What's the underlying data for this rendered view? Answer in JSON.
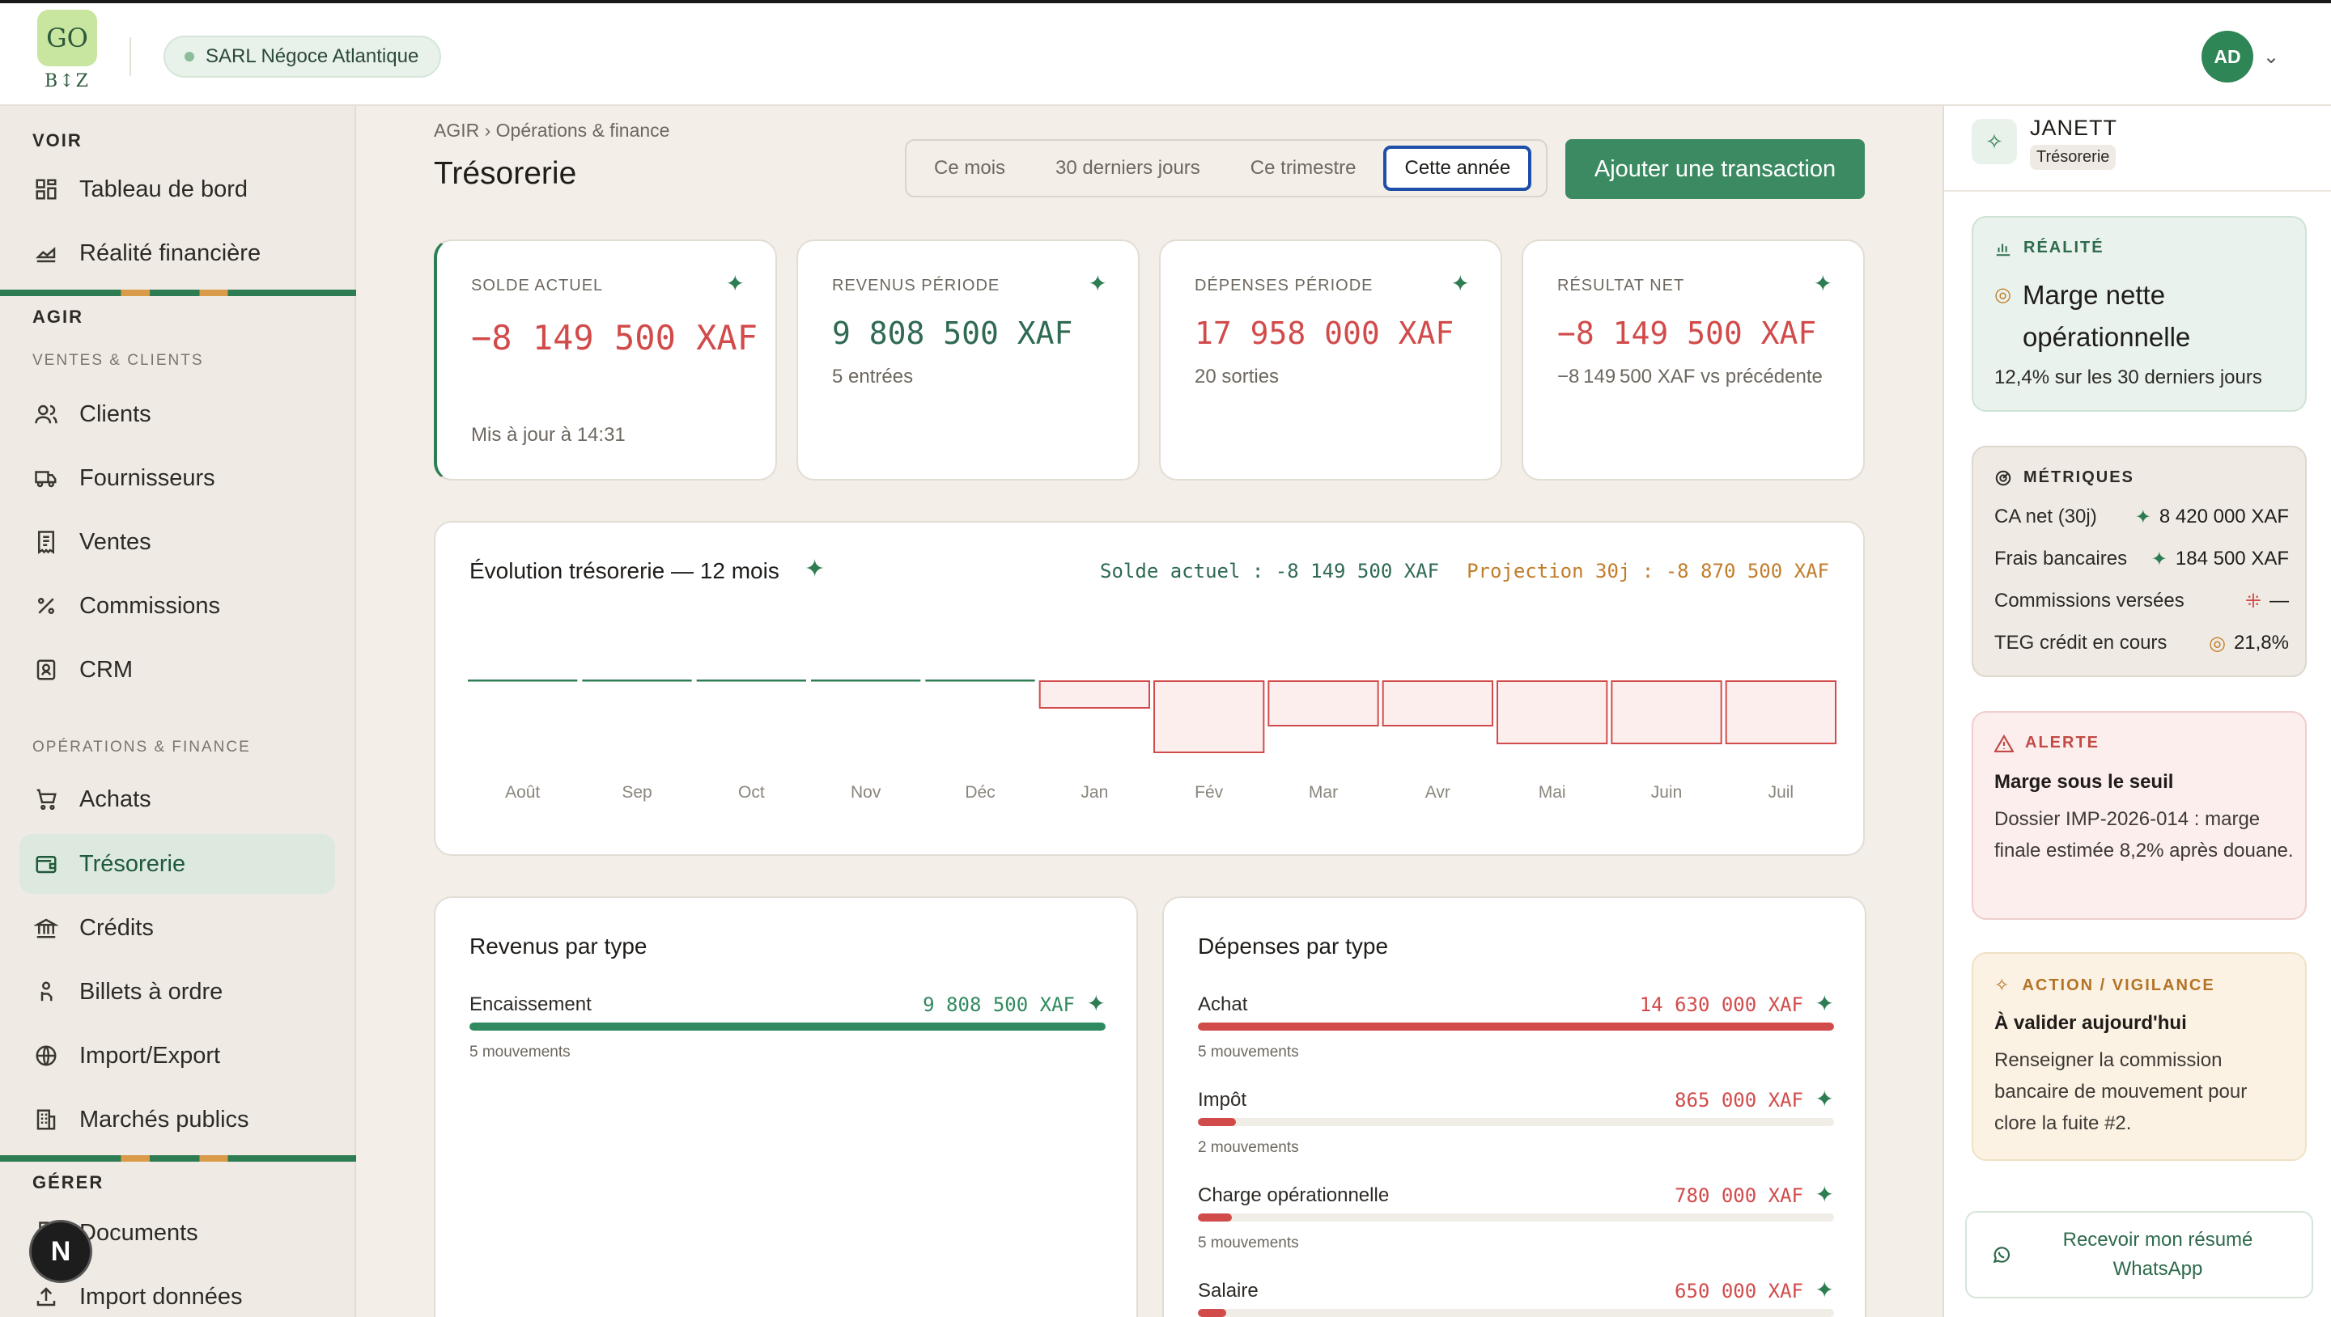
{
  "app": {
    "logo_top": "GO",
    "logo_bottom": "B↕Z",
    "company": "SARL Négoce Atlantique",
    "user_initials": "AD"
  },
  "sidebar": {
    "sec_voir": "VOIR",
    "voir_items": [
      "Tableau de bord",
      "Réalité financière"
    ],
    "sec_agir": "AGIR",
    "sub_ventes": "VENTES & CLIENTS",
    "ventes_items": [
      "Clients",
      "Fournisseurs",
      "Ventes",
      "Commissions",
      "CRM"
    ],
    "sub_ops": "OPÉRATIONS & FINANCE",
    "ops_items": [
      "Achats",
      "Trésorerie",
      "Crédits",
      "Billets à ordre",
      "Import/Export",
      "Marchés publics"
    ],
    "sec_gerer": "GÉRER",
    "gerer_items": [
      "Documents",
      "Import données"
    ],
    "fab": "N"
  },
  "page": {
    "breadcrumb": "AGIR › Opérations & finance",
    "title": "Trésorerie",
    "periods": [
      "Ce mois",
      "30 derniers jours",
      "Ce trimestre",
      "Cette année"
    ],
    "selected_period": "Cette année",
    "add_button": "Ajouter une transaction"
  },
  "kpis": [
    {
      "label": "SOLDE ACTUEL",
      "value": "−8 149 500 XAF",
      "sub": "Mis à jour à 14:31"
    },
    {
      "label": "REVENUS PÉRIODE",
      "value": "9 808 500 XAF",
      "sub": "5 entrées"
    },
    {
      "label": "DÉPENSES PÉRIODE",
      "value": "17 958 000 XAF",
      "sub": "20 sorties"
    },
    {
      "label": "RÉSULTAT NET",
      "value": "−8 149 500 XAF",
      "sub": "−8 149 500 XAF vs précédente"
    }
  ],
  "evolution": {
    "title": "Évolution trésorerie — 12 mois",
    "legend_balance": "Solde actuel : -8 149 500 XAF",
    "legend_projection": "Projection 30j : -8 870 500 XAF"
  },
  "chart_data": {
    "type": "bar",
    "categories": [
      "Août",
      "Sep",
      "Oct",
      "Nov",
      "Déc",
      "Jan",
      "Fév",
      "Mar",
      "Avr",
      "Mai",
      "Juin",
      "Juil"
    ],
    "values": [
      0,
      0,
      0,
      0,
      0,
      -1.5,
      -4.0,
      -2.5,
      -2.5,
      -3.5,
      -3.5,
      -3.5
    ],
    "colors": {
      "positive": "#2e7d52",
      "negative": "#d24b4b",
      "negative_fill": "#fbeeed"
    }
  },
  "revenus": {
    "title": "Revenus par type",
    "rows": [
      {
        "name": "Encaissement",
        "amount": "9 808 500 XAF",
        "count": "5 mouvements",
        "share": 1.0
      }
    ]
  },
  "depenses": {
    "title": "Dépenses par type",
    "rows": [
      {
        "name": "Achat",
        "amount": "14 630 000 XAF",
        "count": "5 mouvements",
        "share": 1.0
      },
      {
        "name": "Impôt",
        "amount": "865 000 XAF",
        "count": "2 mouvements",
        "share": 0.06
      },
      {
        "name": "Charge opérationnelle",
        "amount": "780 000 XAF",
        "count": "5 mouvements",
        "share": 0.053
      },
      {
        "name": "Salaire",
        "amount": "650 000 XAF",
        "count": "",
        "share": 0.044
      }
    ]
  },
  "assistant": {
    "name": "JANETT",
    "tag": "Trésorerie",
    "realite": {
      "header": "RÉALITÉ",
      "title": "Marge nette opérationnelle",
      "text": "12,4% sur les 30 derniers jours"
    },
    "metriques": {
      "header": "MÉTRIQUES",
      "rows": [
        {
          "label": "CA net (30j)",
          "value": "8 420 000 XAF"
        },
        {
          "label": "Frais bancaires",
          "value": "184 500 XAF"
        },
        {
          "label": "Commissions versées",
          "value": "—"
        },
        {
          "label": "TEG crédit en cours",
          "value": "21,8%"
        }
      ]
    },
    "alerte": {
      "header": "ALERTE",
      "title": "Marge sous le seuil",
      "text": "Dossier IMP-2026-014 : marge finale estimée 8,2% après douane."
    },
    "action": {
      "header": "ACTION / VIGILANCE",
      "title": "À valider aujourd'hui",
      "text": "Renseigner la commission bancaire de mouvement pour clore la fuite #2."
    },
    "whatsapp": "Recevoir mon résumé WhatsApp",
    "accent": "#2e7d52"
  }
}
